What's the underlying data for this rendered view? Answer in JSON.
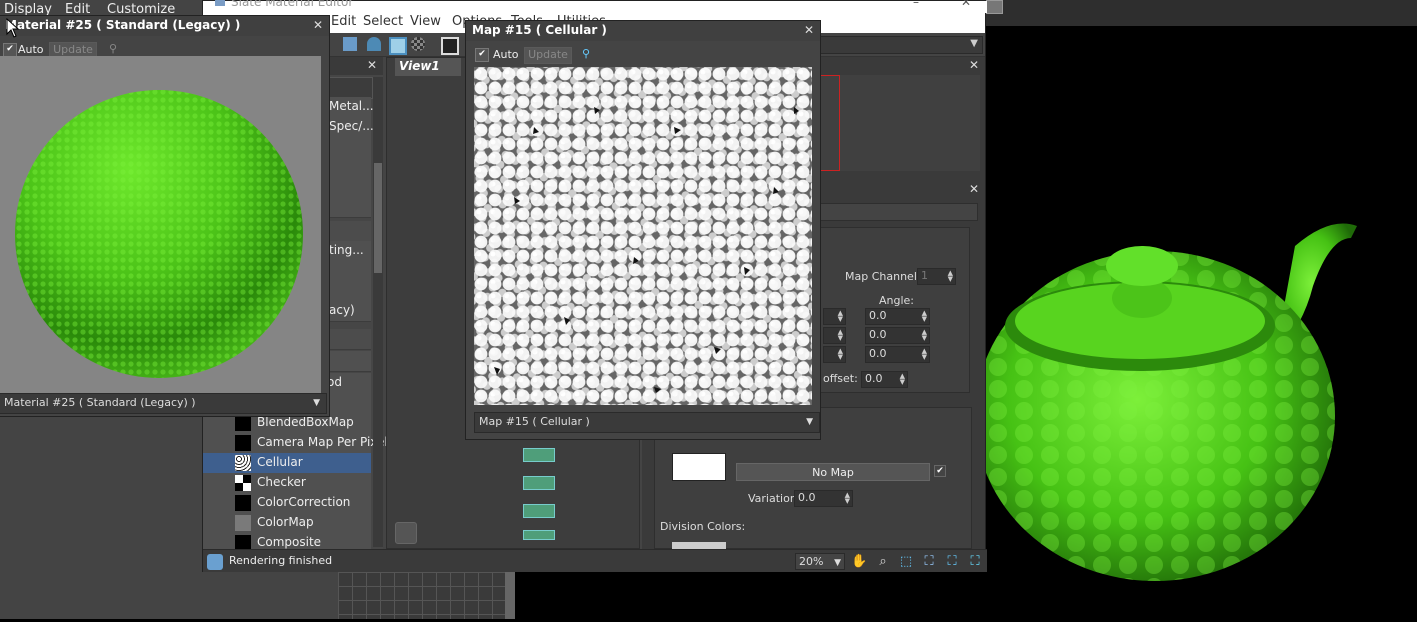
{
  "main_menu": {
    "items": [
      "Display",
      "Edit",
      "Customize"
    ]
  },
  "slate": {
    "title": "Slate Material Editor",
    "menu": [
      "Edit",
      "Select",
      "View",
      "Options",
      "Tools",
      "Utilities"
    ],
    "view_tab": "View1",
    "status": "Rendering finished",
    "zoom": "20%"
  },
  "browser": {
    "partial_labels": [
      "Metal...",
      "Spec/...",
      "ting...",
      "acy)",
      "od"
    ],
    "items": [
      {
        "label": "BlendedBoxMap",
        "swatch": "black"
      },
      {
        "label": "Camera Map Per Pixel",
        "swatch": "black"
      },
      {
        "label": "Cellular",
        "swatch": "cellular",
        "selected": true
      },
      {
        "label": "Checker",
        "swatch": "checker"
      },
      {
        "label": "ColorCorrection",
        "swatch": "black"
      },
      {
        "label": "ColorMap",
        "swatch": "grey"
      },
      {
        "label": "Composite",
        "swatch": "black"
      }
    ]
  },
  "params": {
    "map_channel_label": "Map Channel:",
    "map_channel_value": "1",
    "angle_label": "Angle:",
    "angle_values": [
      "0.0",
      "0.0",
      "0.0"
    ],
    "offset_label": "offset:",
    "offset_value": "0.0",
    "no_map_label": "No Map",
    "variation_label": "Variation:",
    "variation_value": "0.0",
    "division_colors_label": "Division Colors:"
  },
  "material_window": {
    "title": "Material #25  ( Standard (Legacy) )",
    "auto_label": "Auto",
    "update_label": "Update",
    "bottom_label": "Material #25  ( Standard (Legacy) )"
  },
  "map_window": {
    "title": "Map #15  ( Cellular )",
    "auto_label": "Auto",
    "update_label": "Update",
    "bottom_label": "Map #15  ( Cellular )"
  },
  "colors": {
    "selected_row": "#3e5f8e",
    "green_material": "#4fc818",
    "panel": "#444444"
  }
}
